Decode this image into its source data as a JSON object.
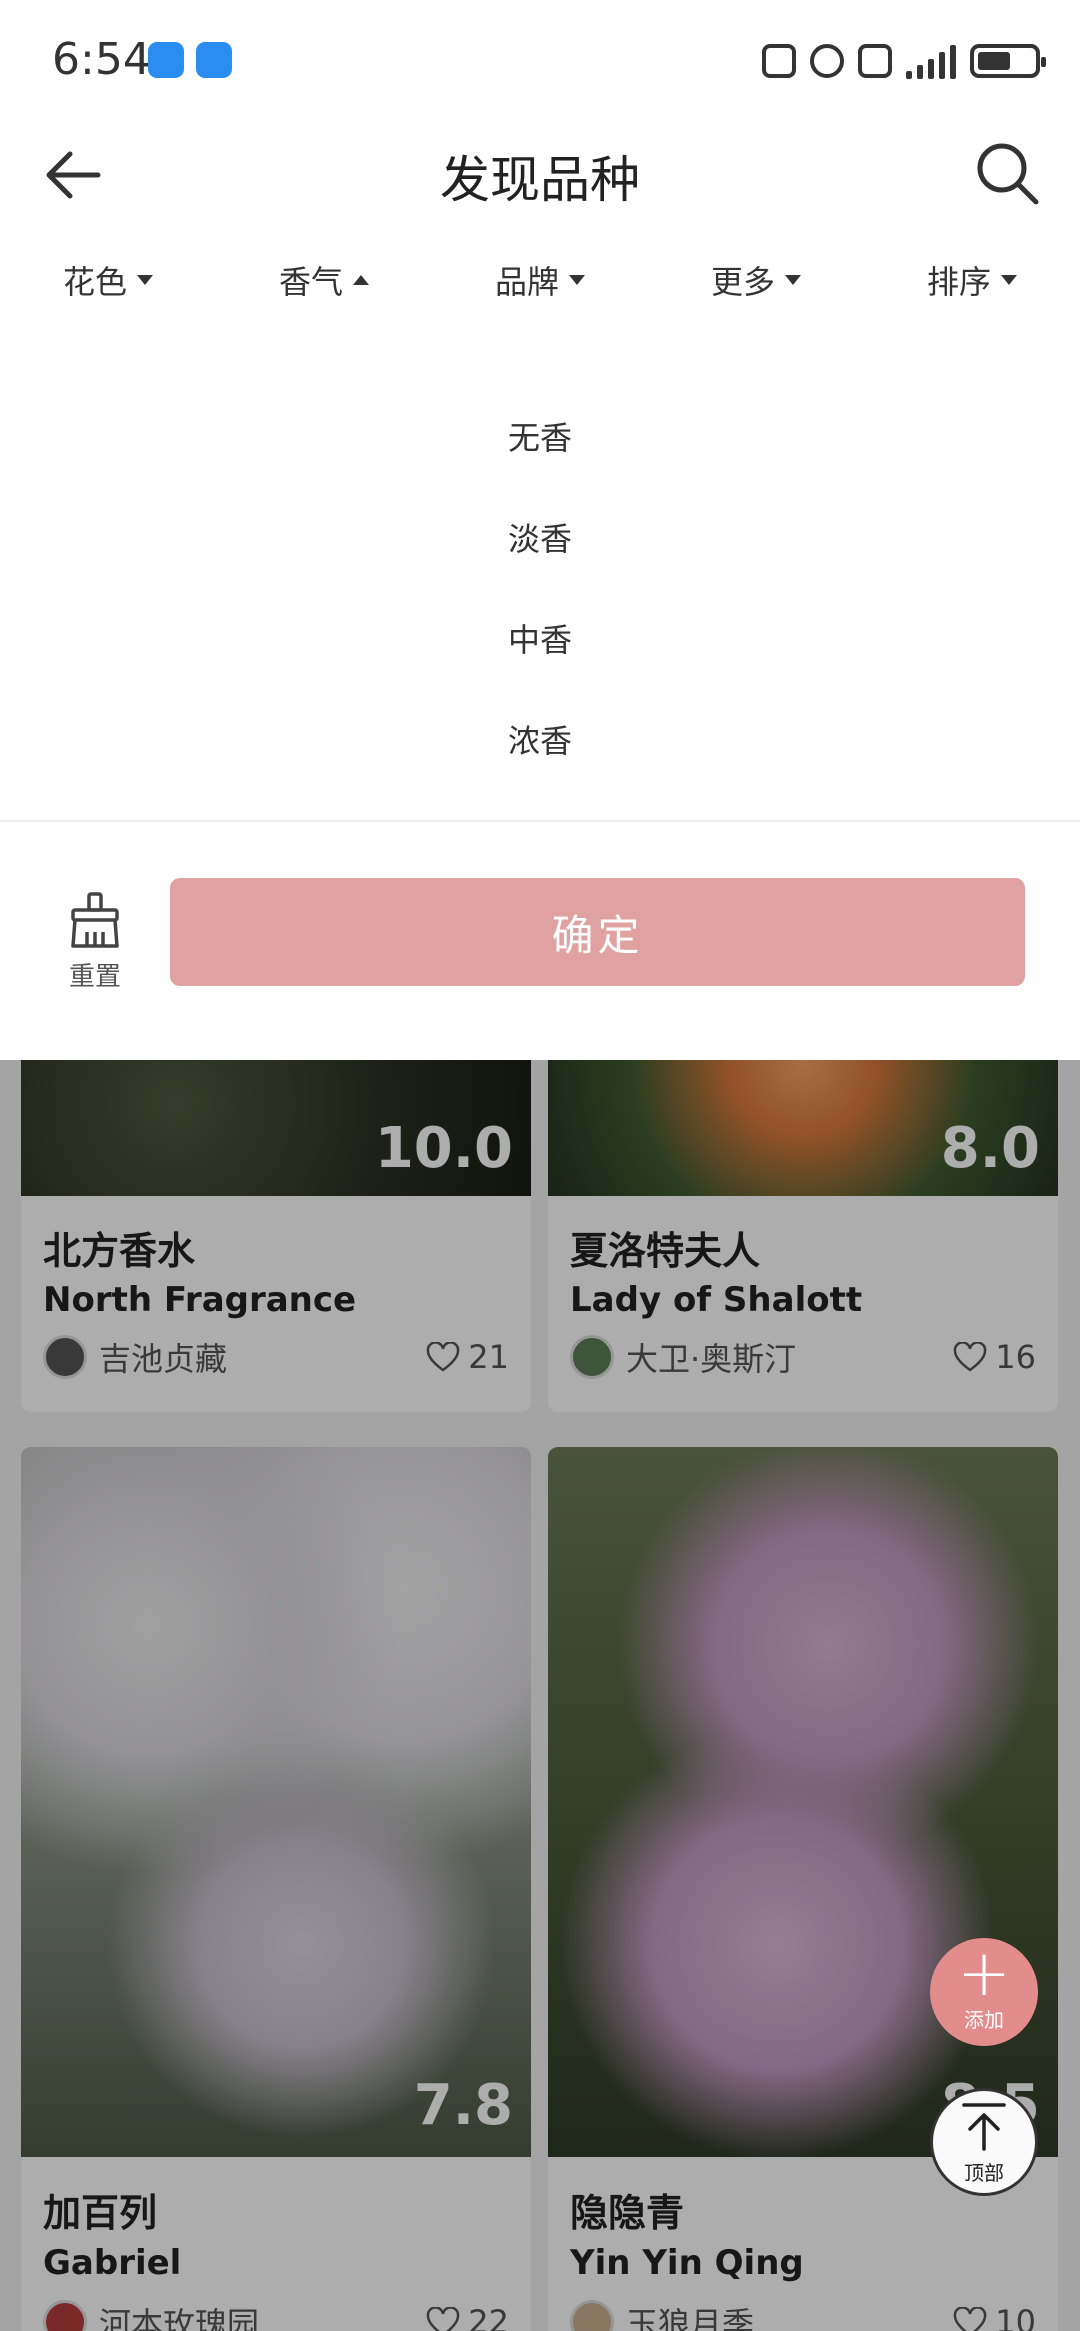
{
  "status_bar": {
    "time": "6:54"
  },
  "header": {
    "title": "发现品种"
  },
  "filters": [
    {
      "label": "花色",
      "state": "collapsed"
    },
    {
      "label": "香气",
      "state": "expanded"
    },
    {
      "label": "品牌",
      "state": "collapsed"
    },
    {
      "label": "更多",
      "state": "collapsed"
    },
    {
      "label": "排序",
      "state": "collapsed"
    }
  ],
  "dropdown": {
    "options": [
      "无香",
      "淡香",
      "中香",
      "浓香"
    ],
    "reset_label": "重置",
    "confirm_label": "确定",
    "confirm_color": "#e0a1a1"
  },
  "cards": [
    {
      "score": "10.0",
      "name": "北方香水",
      "name_en": "North Fragrance",
      "brand": "吉池贞藏",
      "likes": "21"
    },
    {
      "score": "8.0",
      "name": "夏洛特夫人",
      "name_en": "Lady of Shalott",
      "brand": "大卫·奥斯汀",
      "likes": "16"
    },
    {
      "score": "7.8",
      "name": "加百列",
      "name_en": "Gabriel",
      "brand": "河本玫瑰园",
      "likes": "22"
    },
    {
      "score": "8.5",
      "name": "隐隐青",
      "name_en": "Yin Yin Qing",
      "brand": "玉狼月季",
      "likes": "10"
    }
  ],
  "fab": {
    "add_label": "添加",
    "top_label": "顶部",
    "accent": "#e38c8c"
  }
}
